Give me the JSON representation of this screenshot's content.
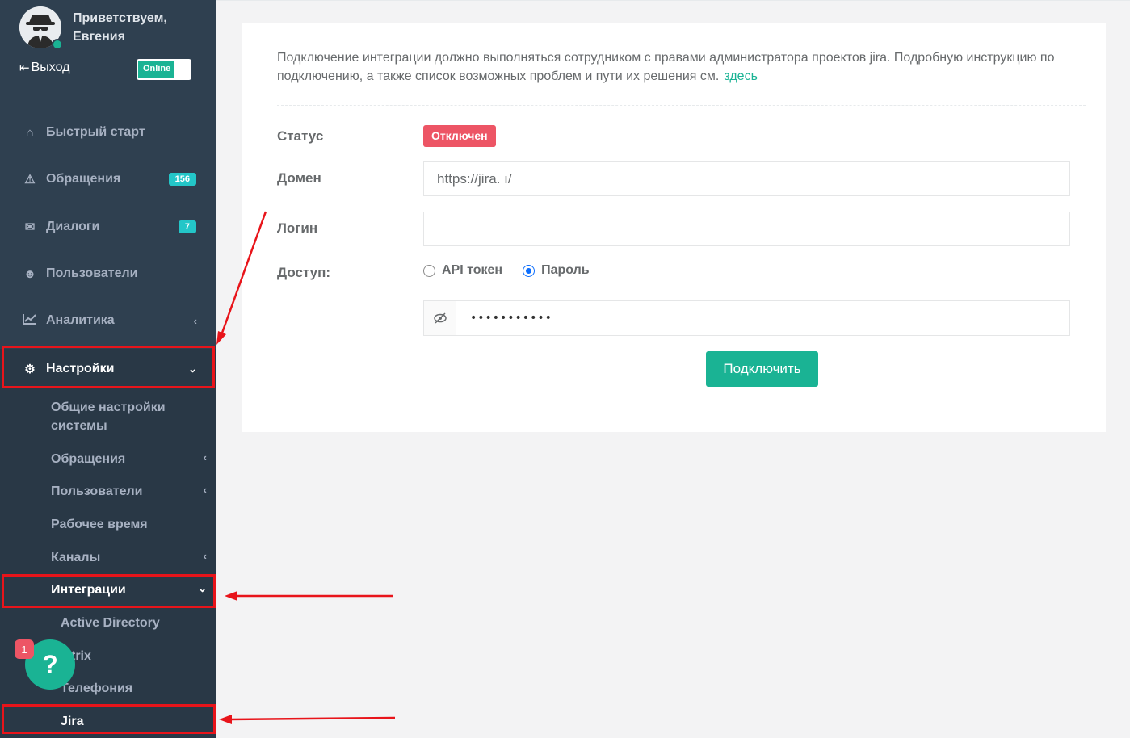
{
  "profile": {
    "greeting_line1": "Приветствуем,",
    "greeting_line2": "Евгения",
    "logout_label": "Выход",
    "status_toggle": "Online"
  },
  "nav": {
    "quick_start": "Быстрый старт",
    "tickets": "Обращения",
    "tickets_count": "156",
    "dialogs": "Диалоги",
    "dialogs_count": "7",
    "users": "Пользователи",
    "analytics": "Аналитика",
    "settings": "Настройки"
  },
  "settings_menu": {
    "general_line1": "Общие настройки",
    "general_line2": "системы",
    "tickets": "Обращения",
    "users": "Пользователи",
    "work_time": "Рабочее время",
    "channels": "Каналы",
    "integrations": "Интеграции"
  },
  "integrations_menu": {
    "active_directory": "Active Directory",
    "bitrix": "trix",
    "telephony": "Телефония",
    "jira": "Jira"
  },
  "help": {
    "icon": "?",
    "badge": "1"
  },
  "form": {
    "info_text": "Подключение интеграции должно выполняться сотрудником с правами администратора проектов jira. Подробную инструкцию по подключению, а также список возможных проблем и пути их решения см.",
    "info_link": "здесь",
    "status_label": "Статус",
    "status_value": "Отключен",
    "domain_label": "Домен",
    "domain_value": "https://jira.                 ı/",
    "login_label": "Логин",
    "login_value": "",
    "access_label": "Доступ:",
    "access_options": [
      "API токен",
      "Пароль"
    ],
    "access_selected": "Пароль",
    "password_value": "•••••••••••",
    "connect_button": "Подключить"
  },
  "colors": {
    "sidebar_bg": "#2f4050",
    "accent": "#1ab394",
    "danger": "#ed5565",
    "badge_info": "#23c6c8",
    "highlight": "#e8141a"
  }
}
